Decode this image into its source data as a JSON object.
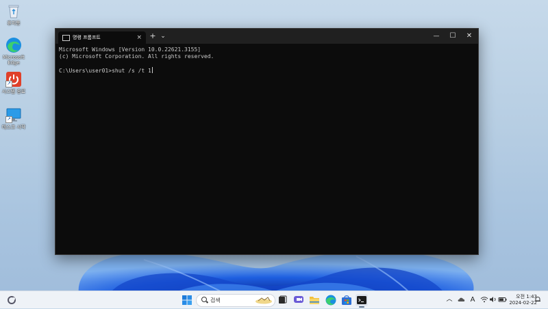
{
  "desktop": {
    "icons": [
      {
        "label": "휴지통",
        "icon": "recycle-bin-icon"
      },
      {
        "label": "Microsoft\nEdge",
        "icon": "edge-icon"
      },
      {
        "label": "시스템 종료",
        "icon": "power-icon"
      },
      {
        "label": "데스크 시작",
        "icon": "monitor-icon"
      }
    ]
  },
  "window": {
    "tab_title": "명령 프롬프트",
    "tab_close": "×",
    "new_tab": "+",
    "tab_dropdown": "⌄",
    "minimize": "—",
    "maximize": "☐",
    "close": "✕",
    "terminal_lines": [
      "Microsoft Windows [Version 10.0.22621.3155]",
      "(c) Microsoft Corporation. All rights reserved.",
      "",
      "C:\\Users\\user01>shut /s /t 1"
    ]
  },
  "taskbar": {
    "search_placeholder": "검색",
    "tray_font_icon": "A",
    "clock_time": "오전 1:43",
    "clock_date": "2024-02-22"
  },
  "colors": {
    "terminal_bg": "#0c0c0c",
    "terminal_text": "#cccccc",
    "titlebar_bg": "#202020",
    "taskbar_bg": "#eef2f7",
    "wallpaper_blue": "#1f5fd6"
  }
}
